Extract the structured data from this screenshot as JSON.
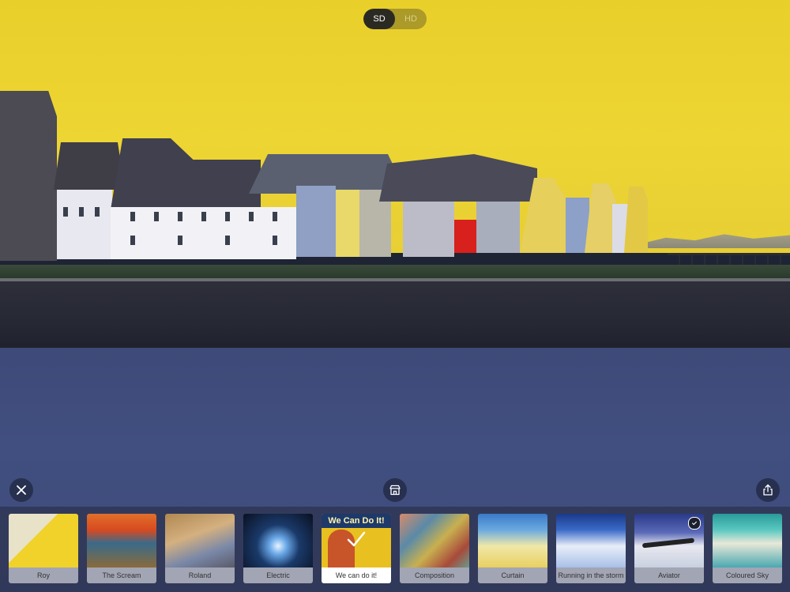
{
  "quality": {
    "options": [
      {
        "label": "SD",
        "selected": true
      },
      {
        "label": "HD",
        "selected": false
      }
    ]
  },
  "controls": {
    "close_icon": "close-icon",
    "store_icon": "store-icon",
    "share_icon": "share-icon"
  },
  "filters": [
    {
      "label": "Roy"
    },
    {
      "label": "The Scream"
    },
    {
      "label": "Roland"
    },
    {
      "label": "Electric"
    },
    {
      "label": "We can do it!",
      "selected": true,
      "poster_text": "We Can Do It!"
    },
    {
      "label": "Composition"
    },
    {
      "label": "Curtain"
    },
    {
      "label": "Running in the storm"
    },
    {
      "label": "Aviator",
      "badge": "check-icon"
    },
    {
      "label": "Coloured Sky"
    }
  ],
  "colors": {
    "sky": "#e9cf2a",
    "water": "#3e4a78",
    "selected_label_bg": "#ffffff"
  }
}
